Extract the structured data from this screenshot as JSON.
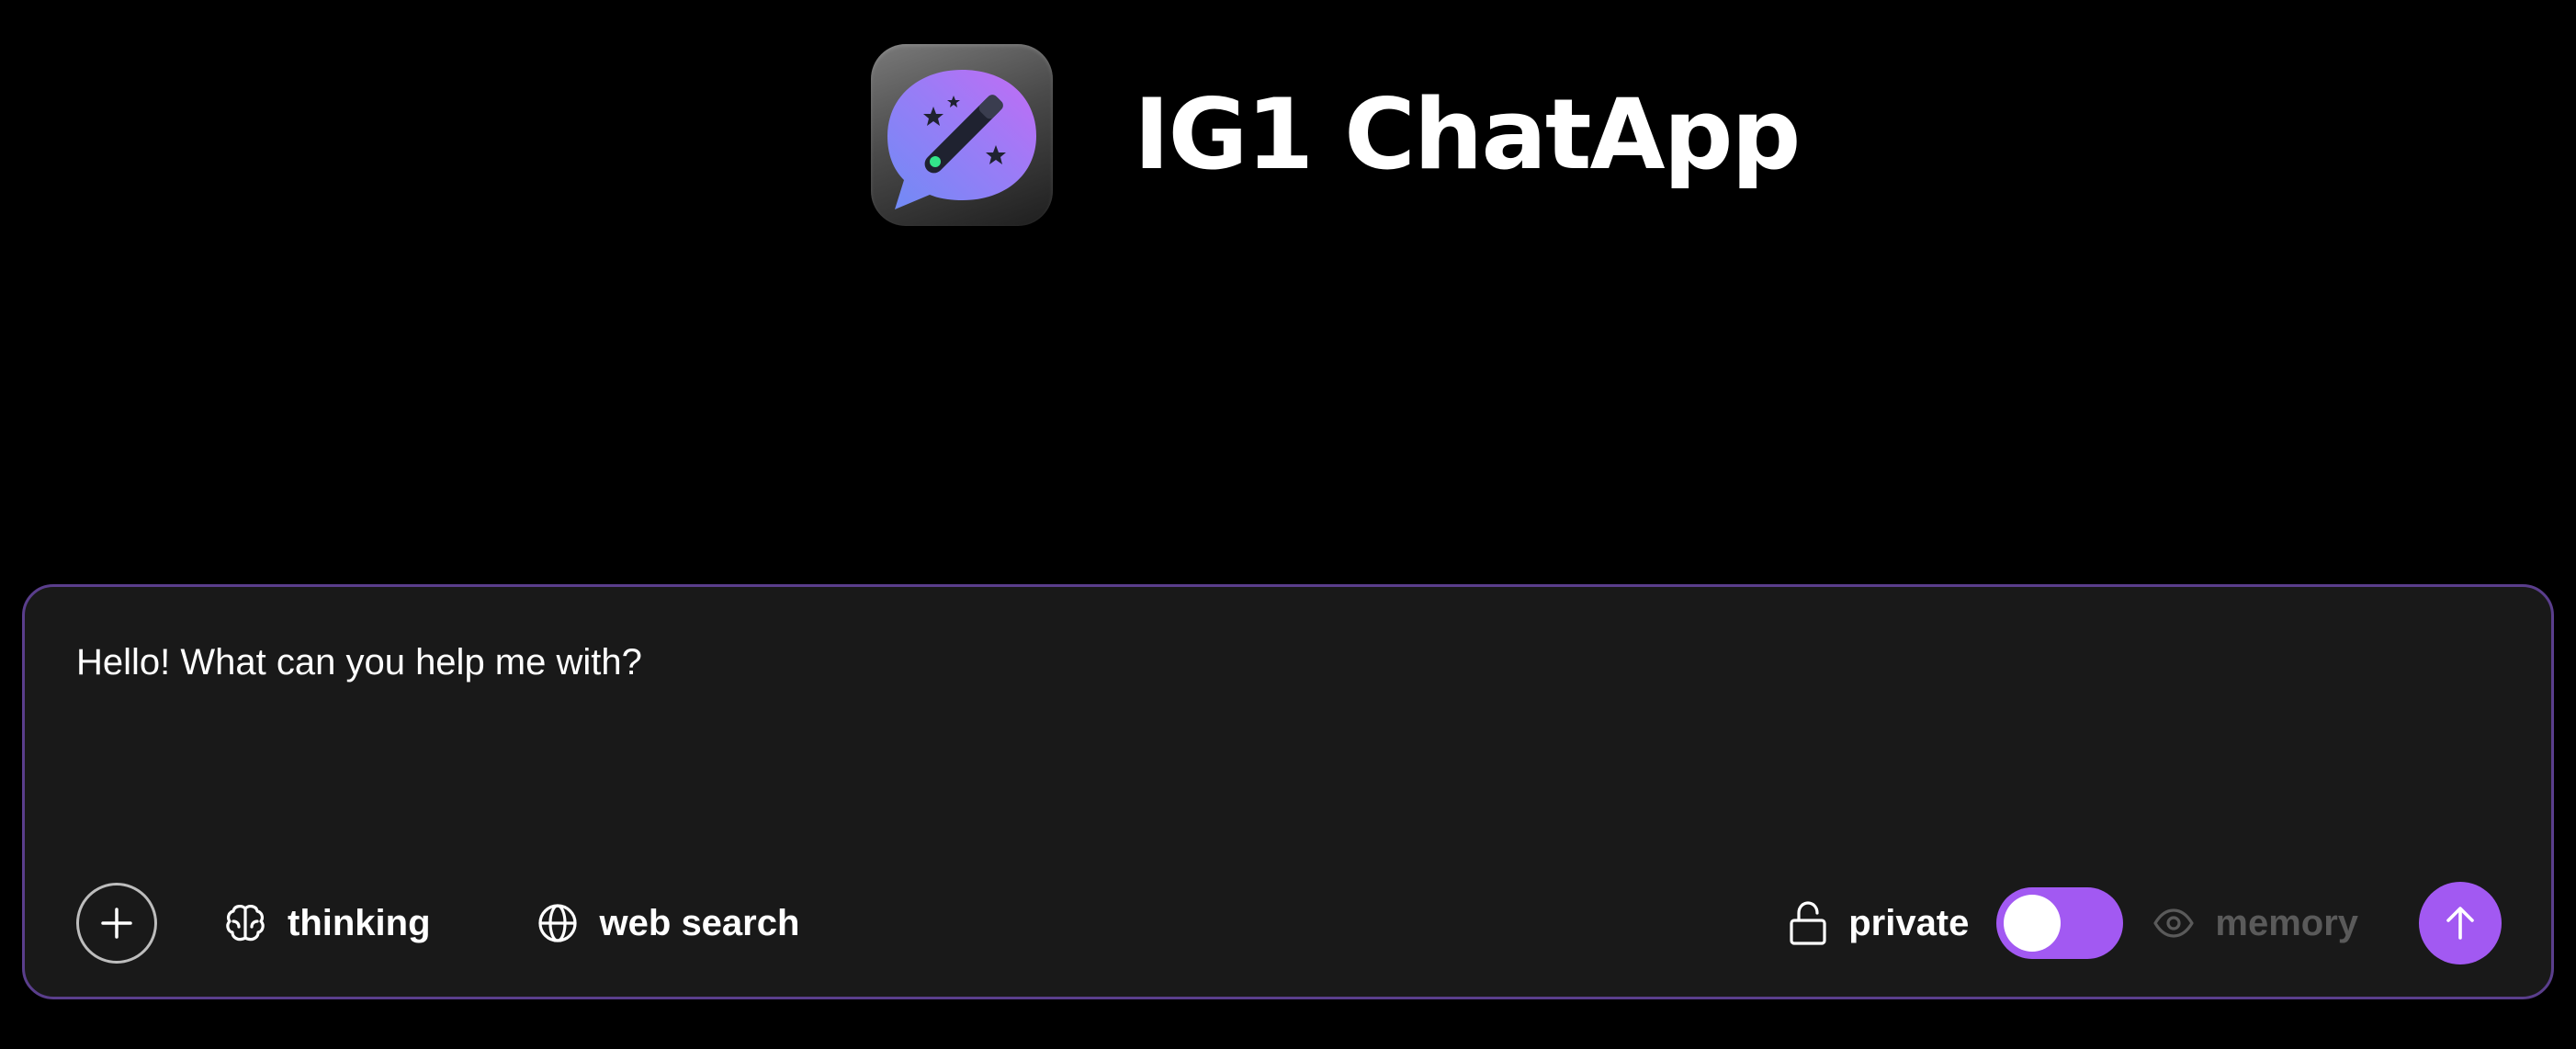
{
  "header": {
    "title": "IG1 ChatApp",
    "logo_icon": "chat-bubble-magic-wand-icon"
  },
  "composer": {
    "placeholder": "Hello! What can you help me with?",
    "value": "",
    "attach_icon": "plus-icon",
    "thinking": {
      "label": "thinking",
      "icon": "brain-icon"
    },
    "web_search": {
      "label": "web search",
      "icon": "globe-icon"
    },
    "private": {
      "label": "private",
      "icon": "lock-icon"
    },
    "private_toggle_on": true,
    "memory": {
      "label": "memory",
      "icon": "eye-icon",
      "disabled": true
    },
    "send_icon": "arrow-up-icon"
  },
  "colors": {
    "background": "#000000",
    "composer_background": "#191919",
    "composer_border": "#5a3e8c",
    "accent": "#a259f2",
    "muted_text": "#5a5a5a",
    "text": "#ffffff"
  }
}
